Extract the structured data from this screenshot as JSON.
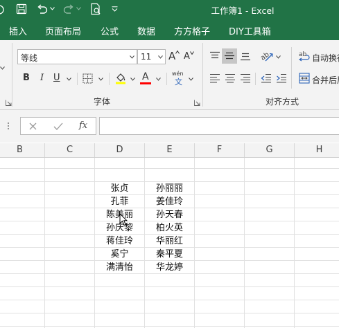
{
  "title_bar": {
    "title": "工作簿1  -  Excel",
    "quick_access": [
      "save-icon",
      "undo-icon",
      "redo-icon",
      "print-preview-icon",
      "customize-qat-icon"
    ]
  },
  "ribbon_tabs": [
    "插入",
    "页面布局",
    "公式",
    "数据",
    "方方格子",
    "DIY工具箱"
  ],
  "font_group": {
    "font_name": "等线",
    "font_size": "11",
    "grow_label": "A",
    "shrink_label": "A",
    "bold": "B",
    "italic": "I",
    "underline": "U",
    "font_color_letter": "A",
    "phonetic_top": "wén",
    "phonetic_bottom": "文",
    "group_label": "字体",
    "fill_color": "#ffff00",
    "font_color": "#ff0000"
  },
  "alignment_group": {
    "wrap_text_label": "自动换行",
    "merge_center_label": "合并后居",
    "group_label": "对齐方式"
  },
  "formula_bar": {
    "name_box": "",
    "fx_label": "fx",
    "formula": ""
  },
  "columns": [
    "B",
    "C",
    "D",
    "E",
    "F",
    "G",
    "H"
  ],
  "cells": {
    "col_d": [
      "张贞",
      "孔菲",
      "陈美丽",
      "孙庆黎",
      "蒋佳玲",
      "奚宁",
      "满清怡"
    ],
    "col_e": [
      "孙丽丽",
      "姜佳玲",
      "孙天春",
      "柏火英",
      "华丽红",
      "秦平夏",
      "华龙婷"
    ]
  },
  "colors": {
    "excel_green": "#217346",
    "ribbon_bg": "#f3f3f3",
    "gridline": "#e1e1e1"
  }
}
